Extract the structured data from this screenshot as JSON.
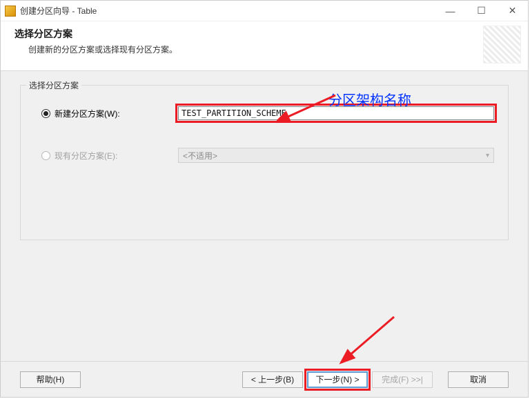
{
  "window": {
    "title": "创建分区向导 - Table"
  },
  "header": {
    "title": "选择分区方案",
    "subtitle": "创建新的分区方案或选择现有分区方案。"
  },
  "fieldset": {
    "legend": "选择分区方案",
    "new_scheme": {
      "label": "新建分区方案(W):",
      "value": "TEST_PARTITION_SCHEME"
    },
    "existing_scheme": {
      "label": "现有分区方案(E):",
      "dropdown_text": "<不适用>"
    }
  },
  "annotation": {
    "label": "分区架构名称"
  },
  "footer": {
    "help": "帮助(H)",
    "back": "< 上一步(B)",
    "next": "下一步(N) >",
    "finish": "完成(F) >>|",
    "cancel": "取消"
  },
  "win_controls": {
    "minimize": "—",
    "maximize": "☐",
    "close": "✕"
  }
}
